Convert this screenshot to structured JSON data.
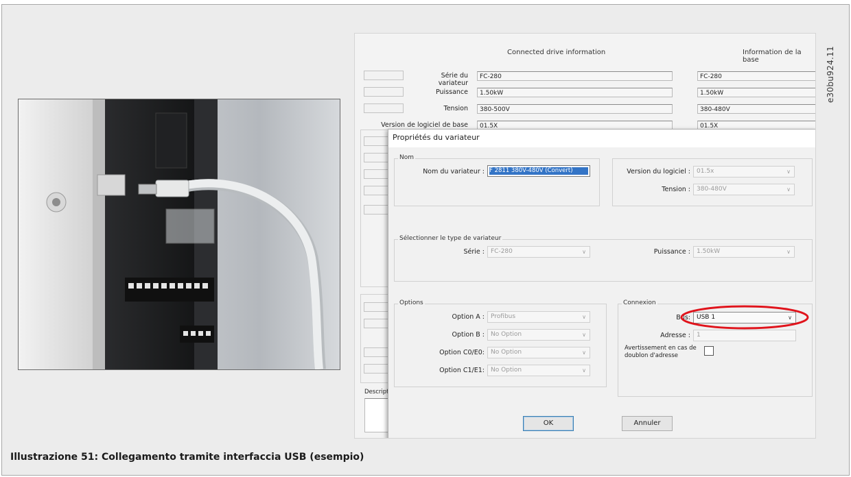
{
  "figure_code": "e30bu924.11",
  "caption": "Illustrazione 51: Collegamento tramite interfaccia USB (esempio)",
  "background_window": {
    "col1_heading": "Connected drive information",
    "col2_heading": "Information de la base",
    "rows": [
      {
        "label": "Série du variateur",
        "value": "FC-280",
        "value2": "FC-280"
      },
      {
        "label": "Puissance",
        "value": "1.50kW",
        "value2": "1.50kW"
      },
      {
        "label": "Tension",
        "value": "380-500V",
        "value2": "380-480V"
      },
      {
        "label": "Version de logiciel de base",
        "value": "01.5X",
        "value2": "01.5X"
      }
    ],
    "descr_label": "Descripti"
  },
  "dialog": {
    "title": "Propriétés du variateur",
    "nom_group": "Nom",
    "drive_name_label": "Nom du variateur :",
    "drive_name_value": "F 2811 380V-480V (Convert)",
    "software_label": "Version du logiciel :",
    "software_value": "01.5x",
    "tension_label": "Tension :",
    "tension_value": "380-480V",
    "type_group": "Sélectionner le type de variateur",
    "serie_label": "Série :",
    "serie_value": "FC-280",
    "puissance_label": "Puissance :",
    "puissance_value": "1.50kW",
    "options_group": "Options",
    "options": [
      {
        "label": "Option A :",
        "value": "Profibus"
      },
      {
        "label": "Option B :",
        "value": "No Option"
      },
      {
        "label": "Option C0/E0:",
        "value": "No Option"
      },
      {
        "label": "Option C1/E1:",
        "value": "No Option"
      }
    ],
    "connexion_group": "Connexion",
    "bus_label": "Bus:",
    "bus_value": "USB 1",
    "adresse_label": "Adresse :",
    "adresse_value": "1",
    "warning_label": "Avertissement en cas de doublon d'adresse",
    "ok_label": "OK",
    "cancel_label": "Annuler"
  },
  "colors": {
    "highlight_ellipse": "#e0141c",
    "selection": "#3374c6"
  }
}
